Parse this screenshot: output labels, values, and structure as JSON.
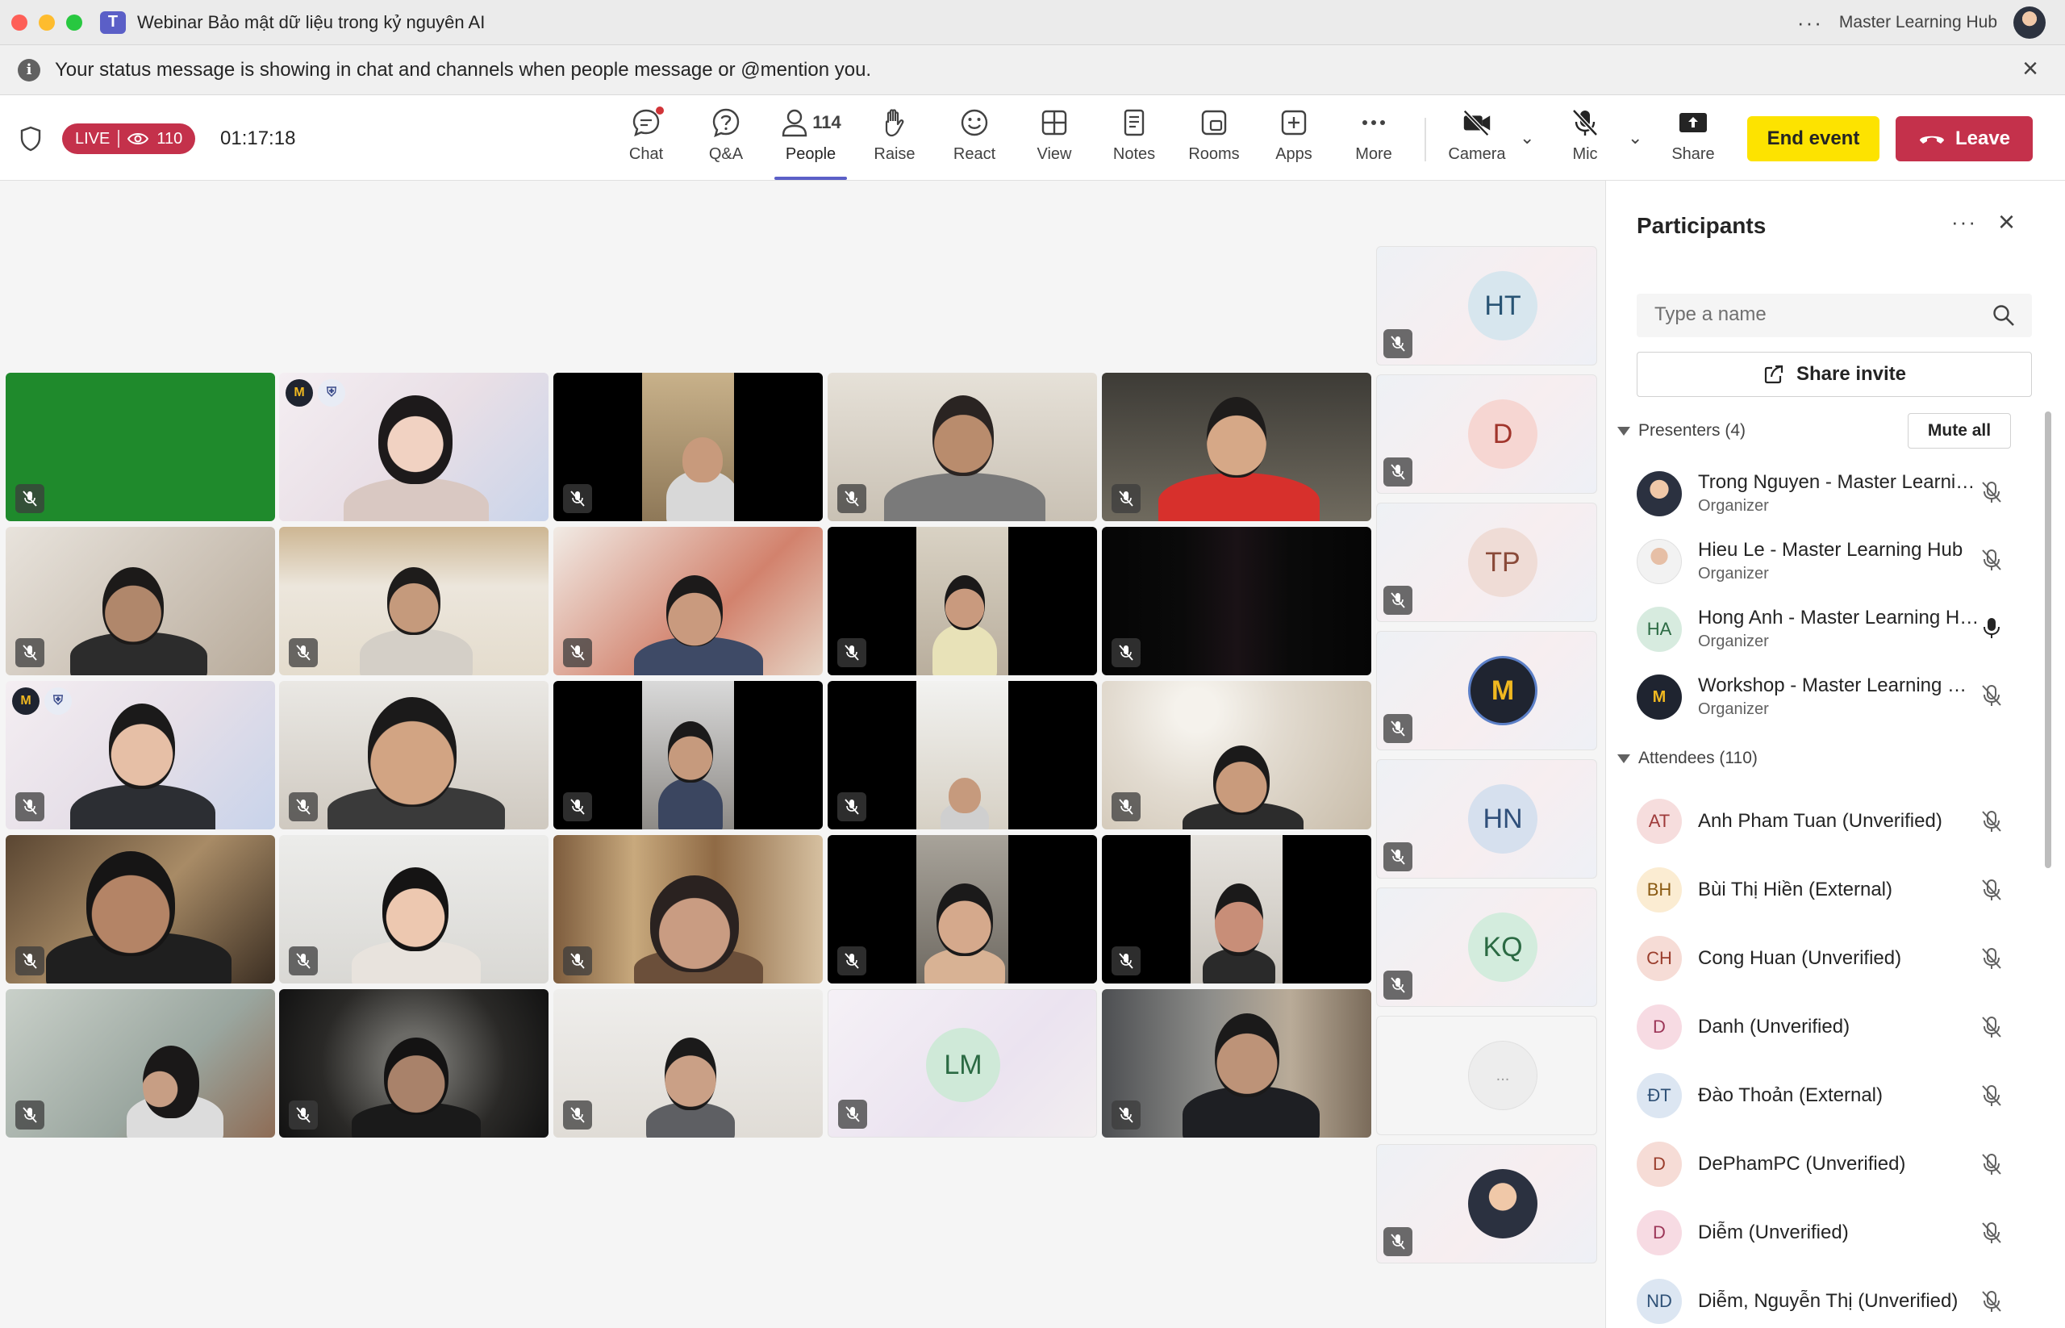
{
  "window": {
    "title": "Webinar Bảo mật dữ liệu trong kỷ nguyên AI",
    "more": "···",
    "org": "Master Learning Hub"
  },
  "banner": {
    "text": "Your status message is showing in chat and channels when people message or @mention you.",
    "close": "×"
  },
  "toolbar": {
    "live_label": "LIVE",
    "viewers": "110",
    "timer": "01:17:18",
    "tools": [
      {
        "id": "chat",
        "label": "Chat"
      },
      {
        "id": "qa",
        "label": "Q&A"
      },
      {
        "id": "people",
        "label": "People",
        "count": "114"
      },
      {
        "id": "raise",
        "label": "Raise"
      },
      {
        "id": "react",
        "label": "React"
      },
      {
        "id": "view",
        "label": "View"
      },
      {
        "id": "notes",
        "label": "Notes"
      },
      {
        "id": "rooms",
        "label": "Rooms"
      },
      {
        "id": "apps",
        "label": "Apps"
      },
      {
        "id": "more",
        "label": "More"
      },
      {
        "id": "camera",
        "label": "Camera"
      },
      {
        "id": "mic",
        "label": "Mic"
      },
      {
        "id": "share",
        "label": "Share"
      }
    ],
    "end_event": "End event",
    "leave": "Leave"
  },
  "stage": {
    "tile_initials": "LM",
    "side_tiles": [
      "HT",
      "D",
      "TP",
      "",
      "HN",
      "KQ",
      "...",
      ""
    ]
  },
  "panel": {
    "title": "Participants",
    "more": "···",
    "close": "×",
    "search_placeholder": "Type a name",
    "share_invite": "Share invite",
    "presenters_header": "Presenters (4)",
    "mute_all": "Mute all",
    "presenters": [
      {
        "name": "Trong Nguyen - Master Learning Hub",
        "role": "Organizer",
        "initials": ""
      },
      {
        "name": "Hieu Le - Master Learning Hub",
        "role": "Organizer",
        "initials": ""
      },
      {
        "name": "Hong Anh - Master Learning Hub",
        "role": "Organizer",
        "initials": "HA"
      },
      {
        "name": "Workshop - Master Learning Hub",
        "role": "Organizer",
        "initials": ""
      }
    ],
    "attendees_header": "Attendees (110)",
    "attendees": [
      {
        "name": "Anh Pham Tuan (Unverified)",
        "initials": "AT"
      },
      {
        "name": "Bùi Thị Hiền (External)",
        "initials": "BH"
      },
      {
        "name": "Cong Huan (Unverified)",
        "initials": "CH"
      },
      {
        "name": "Danh (Unverified)",
        "initials": "D"
      },
      {
        "name": "Đào Thoản (External)",
        "initials": "ĐT"
      },
      {
        "name": "DePhamPC (Unverified)",
        "initials": "D"
      },
      {
        "name": "Diễm (Unverified)",
        "initials": "D"
      },
      {
        "name": "Diễm, Nguyễn Thị (Unverified)",
        "initials": "ND"
      }
    ]
  },
  "colors": {
    "accent": "#5b5fc7",
    "live": "#c4314b",
    "end_event": "#fde300",
    "leave": "#c4314b"
  }
}
